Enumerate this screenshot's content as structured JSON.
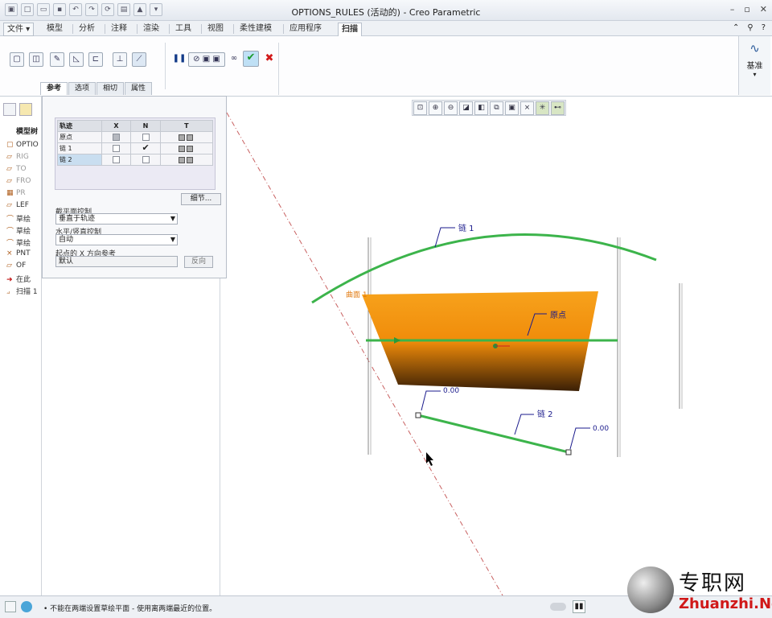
{
  "window": {
    "title": "OPTIONS_RULES (活动的) - Creo Parametric"
  },
  "menu": {
    "file": "文件",
    "tabs": [
      "模型",
      "分析",
      "注释",
      "渲染",
      "工具",
      "视图",
      "柔性建模",
      "应用程序"
    ],
    "active_tab": "扫描"
  },
  "ribbon": {
    "subtabs": [
      "参考",
      "选项",
      "相切",
      "属性"
    ],
    "active_subtab": "参考",
    "base_label": "基准"
  },
  "ref_panel": {
    "headers": [
      "轨迹",
      "X",
      "N",
      "T"
    ],
    "rows": [
      {
        "name": "原点",
        "x": "grey",
        "n": "",
        "t": ""
      },
      {
        "name": "链 1",
        "x": "",
        "n": "✔",
        "t": ""
      },
      {
        "name": "链 2",
        "x": "",
        "n": "",
        "t": ""
      }
    ],
    "details_button": "细节...",
    "section_plane_label": "截平面控制",
    "section_plane_value": "垂直于轨迹",
    "horiz_vert_label": "水平/竖直控制",
    "horiz_vert_value": "自动",
    "start_x_label": "起点的 X 方向参考",
    "start_x_value": "默认",
    "flip_button": "反向"
  },
  "model_tree": {
    "title": "模型树",
    "items": [
      {
        "label": "OPTIO",
        "grey": false
      },
      {
        "label": "RIG",
        "grey": true
      },
      {
        "label": "TO",
        "grey": true
      },
      {
        "label": "FRO",
        "grey": true
      },
      {
        "label": "PR",
        "grey": true
      },
      {
        "label": "LEF",
        "grey": false
      },
      {
        "label": "草绘",
        "grey": false
      },
      {
        "label": "草绘",
        "grey": false
      },
      {
        "label": "草绘",
        "grey": false
      },
      {
        "label": "PNT",
        "grey": false
      },
      {
        "label": "OF",
        "grey": false
      },
      {
        "label": "在此",
        "grey": false
      },
      {
        "label": "扫描 1",
        "grey": false
      }
    ]
  },
  "viewport": {
    "labels": {
      "chain1": "链 1",
      "chain2": "链 2",
      "origin": "原点",
      "surface": "曲面 1",
      "dim1": "0.00",
      "dim2": "0.00"
    },
    "colors": {
      "sweep": "#f09010",
      "trajectory": "#3cb44b",
      "annotation": "#1a1a8c"
    }
  },
  "status": {
    "message": "• 不能在两端设置草绘平面 - 使用离两端最近的位置。"
  },
  "watermark": {
    "cn": "专职网",
    "en": "Zhuanzhi.Net"
  }
}
